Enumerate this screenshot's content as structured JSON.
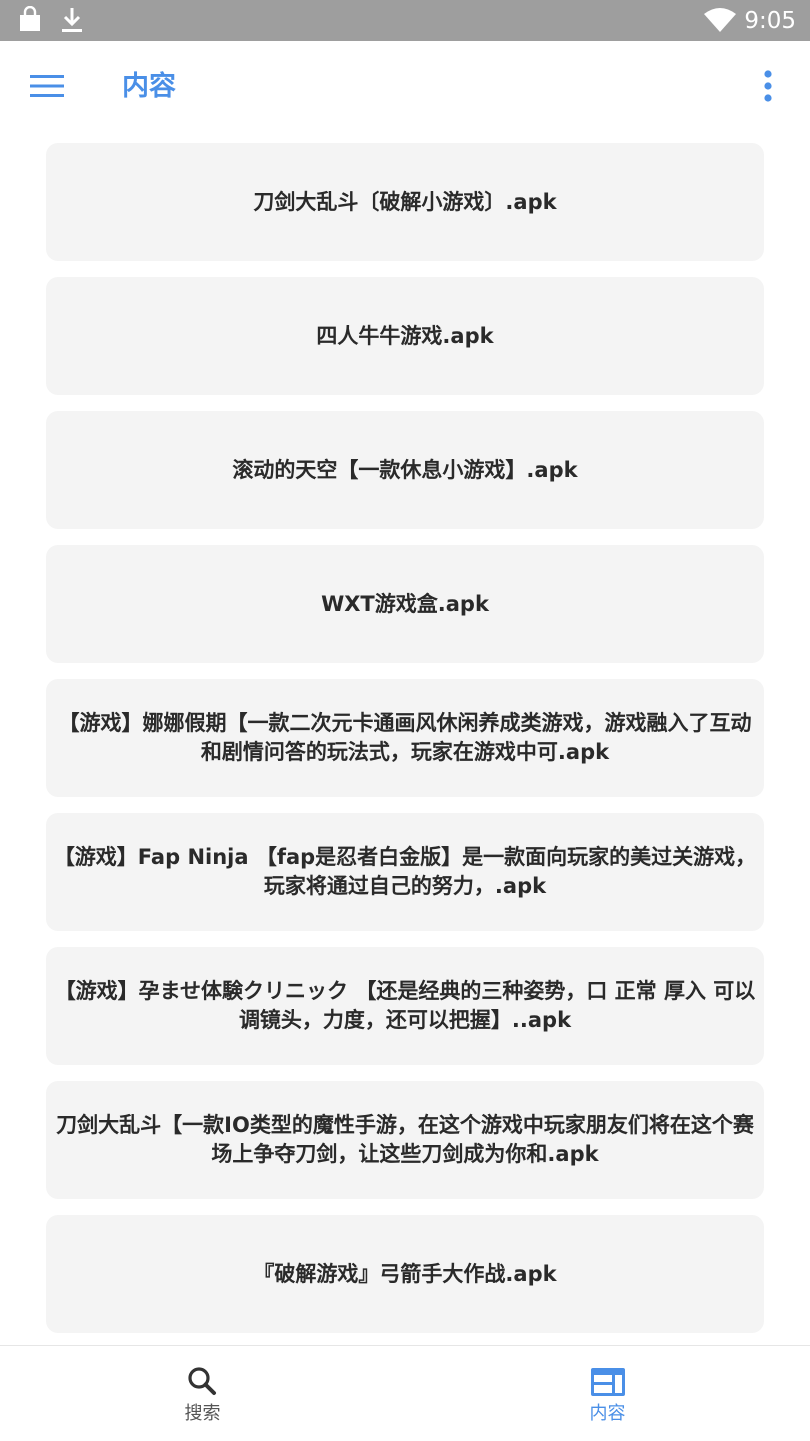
{
  "status_bar": {
    "time": "9:05",
    "left_icons": [
      "shopping-bag-icon",
      "download-icon"
    ],
    "right_icons": [
      "wifi-icon"
    ]
  },
  "app_bar": {
    "title": "内容",
    "left_icon": "menu-icon",
    "right_icon": "more-vert-icon"
  },
  "files": [
    {
      "name": "刀剑大乱斗〔破解小游戏〕.apk"
    },
    {
      "name": "四人牛牛游戏.apk"
    },
    {
      "name": "滚动的天空【一款休息小游戏】.apk"
    },
    {
      "name": "WXT游戏盒.apk"
    },
    {
      "name": "【游戏】娜娜假期【一款二次元卡通画风休闲养成类游戏，游戏融入了互动和剧情问答的玩法式，玩家在游戏中可.apk"
    },
    {
      "name": "【游戏】Fap Ninja 【fap是忍者白金版】是一款面向玩家的美过关游戏，玩家将通过自己的努力，.apk"
    },
    {
      "name": "【游戏】孕ませ体験クリニック 【还是经典的三种姿势，口 正常 厚入 可以调镜头，力度，还可以把握】..apk"
    },
    {
      "name": "刀剑大乱斗【一款IO类型的魔性手游，在这个游戏中玩家朋友们将在这个赛场上争夺刀剑，让这些刀剑成为你和.apk"
    },
    {
      "name": "『破解游戏』弓箭手大作战.apk"
    }
  ],
  "bottom_nav": {
    "tabs": [
      {
        "label": "搜索",
        "icon": "search-icon",
        "active": false
      },
      {
        "label": "内容",
        "icon": "dashboard-icon",
        "active": true
      }
    ]
  },
  "colors": {
    "accent": "#4a8fe7",
    "status_bar": "#9e9e9e",
    "card_background": "#f4f4f4",
    "text": "#2a2a2a"
  }
}
